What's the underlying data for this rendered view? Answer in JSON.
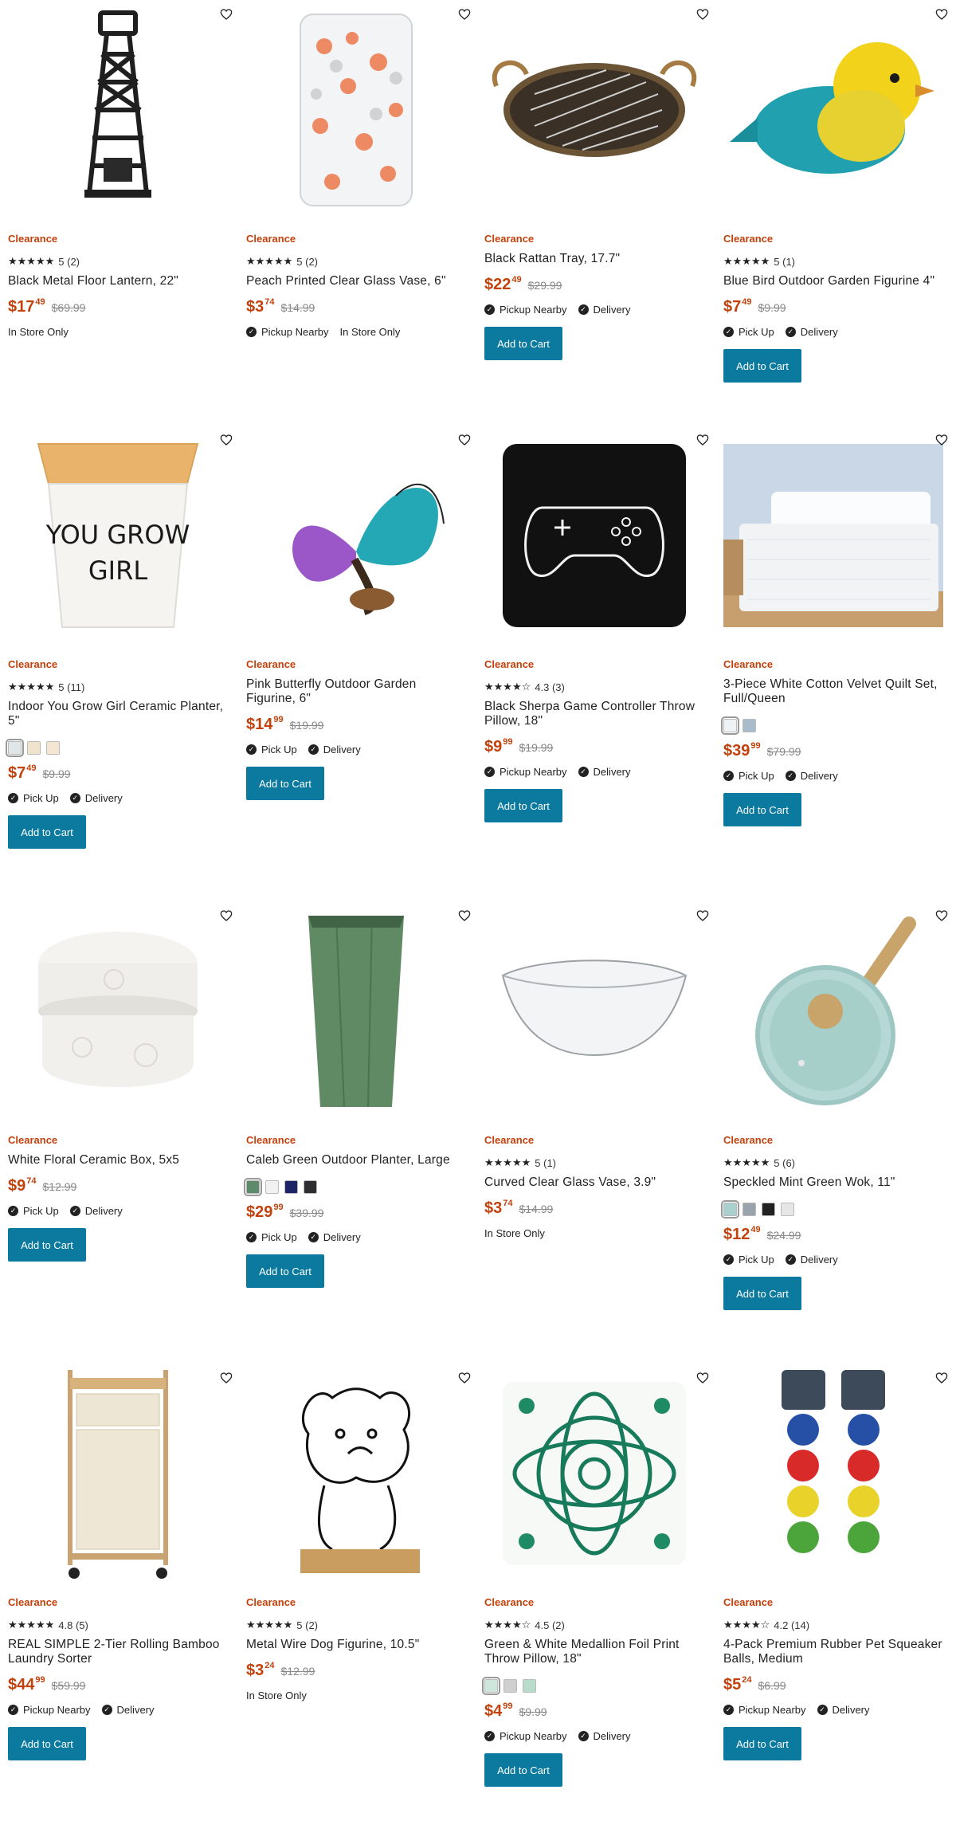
{
  "products": [
    {
      "art": "lantern",
      "badge": "Clearance",
      "rating": "5 (2)",
      "title": "Black Metal Floor Lantern, 22\"",
      "price_main": "$17",
      "price_cents": "49",
      "was": "$69.99",
      "fulfillment": [
        {
          "label": "In Store Only",
          "check": false
        }
      ],
      "add_to_cart": null
    },
    {
      "art": "vase-peach",
      "badge": "Clearance",
      "rating": "5 (2)",
      "title": "Peach Printed Clear Glass Vase, 6\"",
      "price_main": "$3",
      "price_cents": "74",
      "was": "$14.99",
      "fulfillment": [
        {
          "label": "Pickup Nearby",
          "check": true
        },
        {
          "label": "In Store Only",
          "check": false
        }
      ],
      "add_to_cart": null
    },
    {
      "art": "tray",
      "badge": "Clearance",
      "rating": null,
      "title": "Black Rattan Tray, 17.7\"",
      "price_main": "$22",
      "price_cents": "49",
      "was": "$29.99",
      "fulfillment": [
        {
          "label": "Pickup Nearby",
          "check": true
        },
        {
          "label": "Delivery",
          "check": true
        }
      ],
      "add_to_cart": "Add to Cart"
    },
    {
      "art": "bird",
      "badge": "Clearance",
      "rating": "5 (1)",
      "title": "Blue Bird Outdoor Garden Figurine 4\"",
      "price_main": "$7",
      "price_cents": "49",
      "was": "$9.99",
      "fulfillment": [
        {
          "label": "Pick Up",
          "check": true
        },
        {
          "label": "Delivery",
          "check": true
        }
      ],
      "add_to_cart": "Add to Cart"
    },
    {
      "art": "pot",
      "pot_text": [
        "YOU GROW",
        "GIRL"
      ],
      "badge": "Clearance",
      "rating": "5 (11)",
      "title": "Indoor You Grow Girl Ceramic Planter, 5\"",
      "swatches": [
        "#e0e6e8",
        "#efe3cc",
        "#f3e6d3"
      ],
      "price_main": "$7",
      "price_cents": "49",
      "was": "$9.99",
      "fulfillment": [
        {
          "label": "Pick Up",
          "check": true
        },
        {
          "label": "Delivery",
          "check": true
        }
      ],
      "add_to_cart": "Add to Cart"
    },
    {
      "art": "butterfly",
      "badge": "Clearance",
      "rating": null,
      "title": "Pink Butterfly Outdoor Garden Figurine, 6\"",
      "price_main": "$14",
      "price_cents": "99",
      "was": "$19.99",
      "fulfillment": [
        {
          "label": "Pick Up",
          "check": true
        },
        {
          "label": "Delivery",
          "check": true
        }
      ],
      "add_to_cart": "Add to Cart"
    },
    {
      "art": "pillow-controller",
      "badge": "Clearance",
      "rating": "4.3 (3)",
      "title": "Black Sherpa Game Controller Throw Pillow, 18\"",
      "price_main": "$9",
      "price_cents": "99",
      "was": "$19.99",
      "fulfillment": [
        {
          "label": "Pickup Nearby",
          "check": true
        },
        {
          "label": "Delivery",
          "check": true
        }
      ],
      "add_to_cart": "Add to Cart"
    },
    {
      "art": "bed",
      "badge": "Clearance",
      "rating": null,
      "title": "3-Piece White Cotton Velvet Quilt Set, Full/Queen",
      "swatches": [
        "#eef2f5",
        "#a8bccb"
      ],
      "price_main": "$39",
      "price_cents": "99",
      "was": "$79.99",
      "fulfillment": [
        {
          "label": "Pick Up",
          "check": true
        },
        {
          "label": "Delivery",
          "check": true
        }
      ],
      "add_to_cart": "Add to Cart"
    },
    {
      "art": "ceramic-box",
      "badge": "Clearance",
      "rating": null,
      "title": "White Floral Ceramic Box, 5x5",
      "price_main": "$9",
      "price_cents": "74",
      "was": "$12.99",
      "fulfillment": [
        {
          "label": "Pick Up",
          "check": true
        },
        {
          "label": "Delivery",
          "check": true
        }
      ],
      "add_to_cart": "Add to Cart"
    },
    {
      "art": "green-planter",
      "badge": "Clearance",
      "rating": null,
      "title": "Caleb Green Outdoor Planter, Large",
      "swatches": [
        "#5d8a6a",
        "#f1f1f1",
        "#1d2466",
        "#2e2e30"
      ],
      "price_main": "$29",
      "price_cents": "99",
      "was": "$39.99",
      "fulfillment": [
        {
          "label": "Pick Up",
          "check": true
        },
        {
          "label": "Delivery",
          "check": true
        }
      ],
      "add_to_cart": "Add to Cart"
    },
    {
      "art": "bowl",
      "badge": "Clearance",
      "rating": "5 (1)",
      "title": "Curved Clear Glass Vase, 3.9\"",
      "price_main": "$3",
      "price_cents": "74",
      "was": "$14.99",
      "fulfillment": [
        {
          "label": "In Store Only",
          "check": false
        }
      ],
      "add_to_cart": null
    },
    {
      "art": "wok",
      "badge": "Clearance",
      "rating": "5 (6)",
      "title": "Speckled Mint Green Wok, 11\"",
      "swatches": [
        "#a9cfcf",
        "#9aa3ab",
        "#222222",
        "#e6e6e6"
      ],
      "price_main": "$12",
      "price_cents": "49",
      "was": "$24.99",
      "fulfillment": [
        {
          "label": "Pick Up",
          "check": true
        },
        {
          "label": "Delivery",
          "check": true
        }
      ],
      "add_to_cart": "Add to Cart"
    },
    {
      "art": "laundry",
      "badge": "Clearance",
      "rating": "4.8 (5)",
      "title": "REAL SIMPLE 2-Tier Rolling Bamboo Laundry Sorter",
      "price_main": "$44",
      "price_cents": "99",
      "was": "$59.99",
      "fulfillment": [
        {
          "label": "Pickup Nearby",
          "check": true
        },
        {
          "label": "Delivery",
          "check": true
        }
      ],
      "add_to_cart": "Add to Cart"
    },
    {
      "art": "dog",
      "badge": "Clearance",
      "rating": "5 (2)",
      "title": "Metal Wire Dog Figurine, 10.5\"",
      "price_main": "$3",
      "price_cents": "24",
      "was": "$12.99",
      "fulfillment": [
        {
          "label": "In Store Only",
          "check": false
        }
      ],
      "add_to_cart": null
    },
    {
      "art": "medallion",
      "badge": "Clearance",
      "rating": "4.5 (2)",
      "title": "Green & White Medallion Foil Print Throw Pillow, 18\"",
      "swatches": [
        "#cfe6dc",
        "#cfcfcf",
        "#b8dccb"
      ],
      "price_main": "$4",
      "price_cents": "99",
      "was": "$9.99",
      "fulfillment": [
        {
          "label": "Pickup Nearby",
          "check": true
        },
        {
          "label": "Delivery",
          "check": true
        }
      ],
      "add_to_cart": "Add to Cart"
    },
    {
      "art": "balls",
      "badge": "Clearance",
      "rating": "4.2 (14)",
      "title": "4-Pack Premium Rubber Pet Squeaker Balls, Medium",
      "price_main": "$5",
      "price_cents": "24",
      "was": "$6.99",
      "fulfillment": [
        {
          "label": "Pickup Nearby",
          "check": true
        },
        {
          "label": "Delivery",
          "check": true
        }
      ],
      "add_to_cart": "Add to Cart"
    }
  ]
}
